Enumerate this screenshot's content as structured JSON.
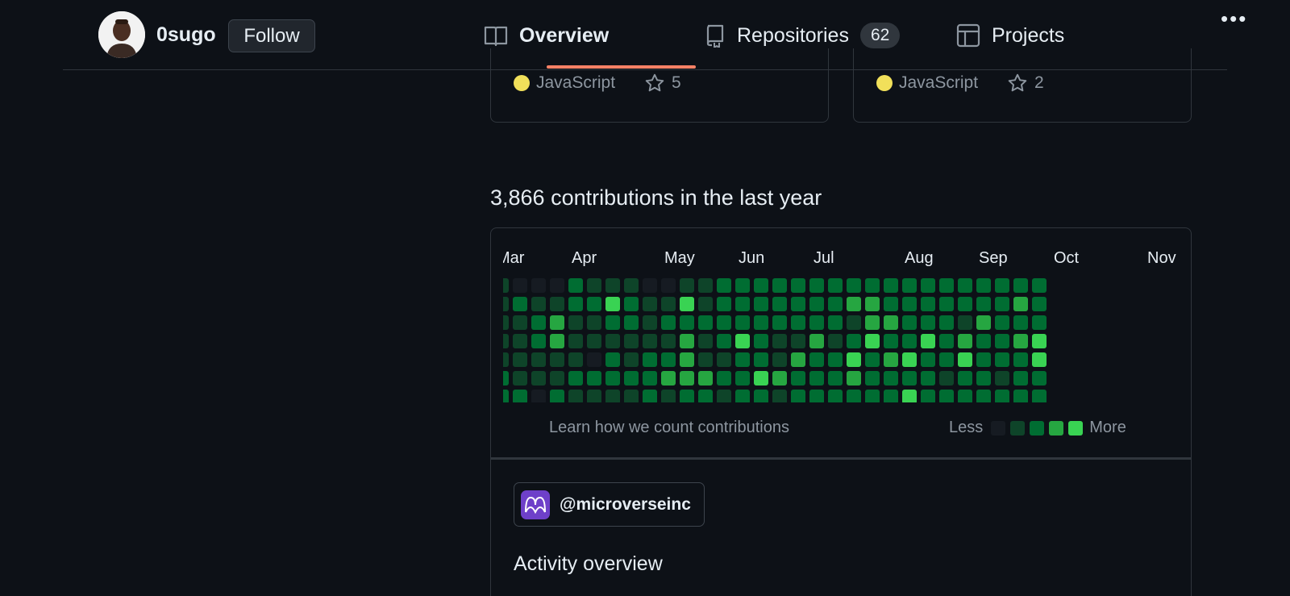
{
  "header": {
    "username": "0sugo",
    "follow_label": "Follow",
    "tabs": [
      {
        "label": "Overview",
        "icon": "book-icon"
      },
      {
        "label": "Repositories",
        "icon": "repo-icon",
        "count": "62"
      },
      {
        "label": "Projects",
        "icon": "table-icon"
      }
    ],
    "more_label": "•••"
  },
  "repos": [
    {
      "language": "JavaScript",
      "stars": "5"
    },
    {
      "language": "JavaScript",
      "stars": "2"
    }
  ],
  "contributions": {
    "title": "3,866 contributions in the last year",
    "months": [
      "Mar",
      "Apr",
      "May",
      "Jun",
      "Jul",
      "Aug",
      "Sep",
      "Oct",
      "Nov"
    ],
    "learn_link": "Learn how we count contributions",
    "legend_less": "Less",
    "legend_more": "More",
    "level_colors": [
      "#161b22",
      "#0e4429",
      "#006d32",
      "#26a641",
      "#39d353"
    ],
    "weeks": [
      [
        1,
        1,
        1,
        1,
        1,
        2,
        2
      ],
      [
        0,
        2,
        1,
        1,
        1,
        1,
        2
      ],
      [
        0,
        1,
        2,
        2,
        1,
        1,
        0
      ],
      [
        0,
        1,
        3,
        3,
        1,
        1,
        2
      ],
      [
        2,
        2,
        1,
        1,
        1,
        2,
        1
      ],
      [
        1,
        2,
        1,
        1,
        0,
        2,
        1
      ],
      [
        1,
        4,
        2,
        1,
        2,
        2,
        1
      ],
      [
        1,
        2,
        2,
        1,
        1,
        2,
        1
      ],
      [
        0,
        1,
        1,
        1,
        2,
        2,
        2
      ],
      [
        0,
        1,
        2,
        1,
        2,
        3,
        1
      ],
      [
        1,
        4,
        2,
        3,
        3,
        3,
        2
      ],
      [
        1,
        1,
        2,
        1,
        1,
        3,
        2
      ],
      [
        2,
        2,
        2,
        2,
        1,
        2,
        1
      ],
      [
        2,
        2,
        2,
        4,
        2,
        2,
        2
      ],
      [
        2,
        2,
        2,
        2,
        2,
        4,
        2
      ],
      [
        2,
        2,
        2,
        1,
        1,
        3,
        1
      ],
      [
        2,
        2,
        2,
        1,
        3,
        2,
        2
      ],
      [
        2,
        2,
        2,
        3,
        2,
        2,
        2
      ],
      [
        2,
        2,
        2,
        1,
        2,
        2,
        2
      ],
      [
        2,
        3,
        1,
        2,
        4,
        3,
        2
      ],
      [
        2,
        3,
        3,
        4,
        2,
        2,
        2
      ],
      [
        2,
        2,
        3,
        2,
        3,
        2,
        2
      ],
      [
        2,
        2,
        2,
        2,
        4,
        2,
        4
      ],
      [
        2,
        2,
        2,
        4,
        2,
        2,
        2
      ],
      [
        2,
        2,
        2,
        2,
        2,
        1,
        2
      ],
      [
        2,
        2,
        1,
        3,
        4,
        2,
        2
      ],
      [
        2,
        2,
        3,
        2,
        2,
        2,
        2
      ],
      [
        2,
        2,
        2,
        2,
        2,
        1,
        2
      ],
      [
        2,
        3,
        2,
        3,
        2,
        2,
        2
      ],
      [
        2,
        2,
        2,
        4,
        4,
        2,
        2
      ]
    ]
  },
  "organization": {
    "handle": "@microverseinc"
  },
  "activity_title": "Activity overview"
}
